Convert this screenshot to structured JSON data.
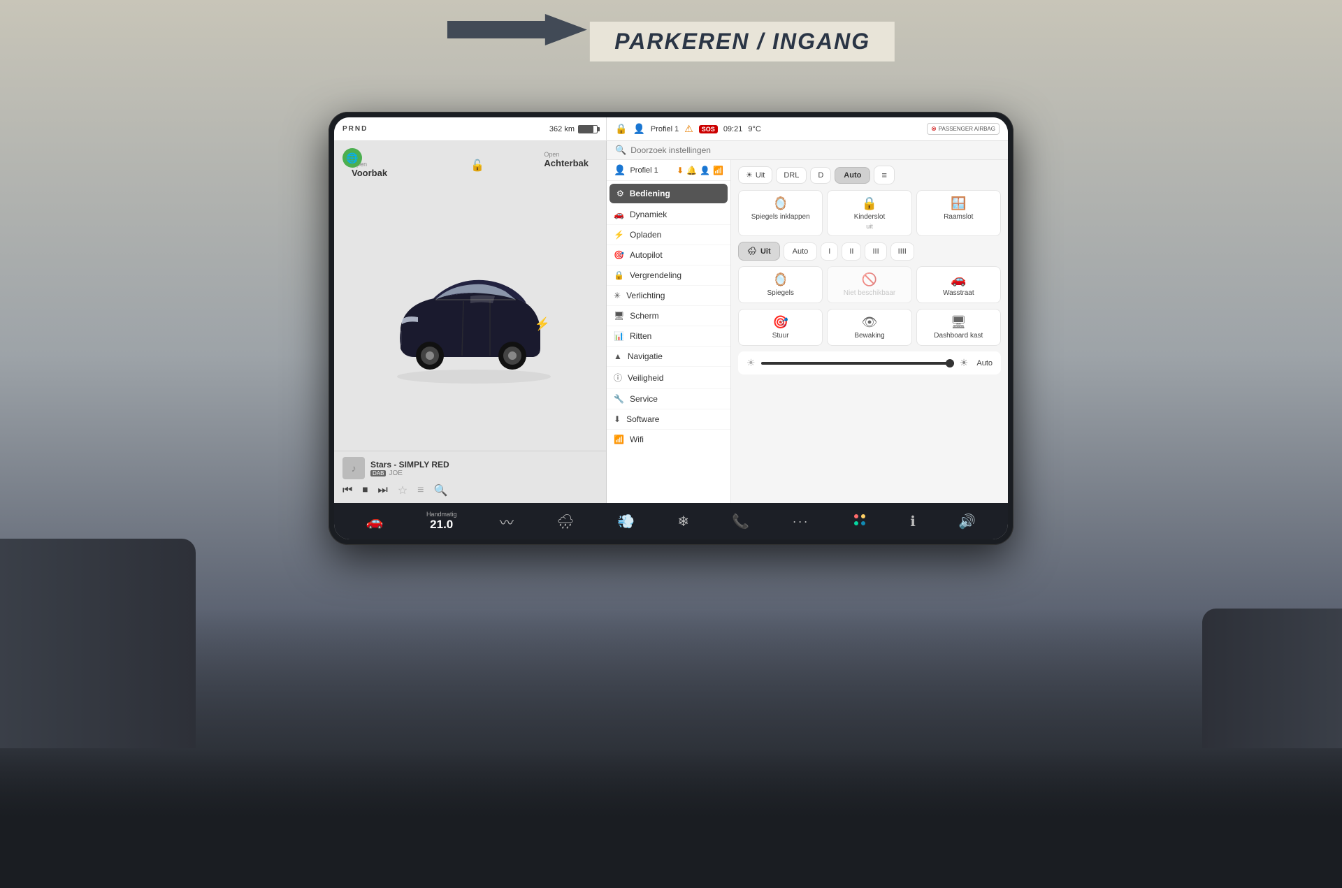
{
  "background": {
    "sign_text": "PARKEREN / INGANG"
  },
  "status_bar": {
    "gear": "PRND",
    "range": "362 km",
    "profile_label": "Profiel 1",
    "sos": "SOS",
    "time": "09:21",
    "temperature": "9°C",
    "passenger_airbag": "PASSENGER AIRBAG"
  },
  "car_panel": {
    "voorbak_open": "Open",
    "voorbak_label": "Voorbak",
    "achterbak_open": "Open",
    "achterbak_label": "Achterbak"
  },
  "music": {
    "title": "Stars - SIMPLY RED",
    "source_badge": "DAB",
    "source_name": "JOE"
  },
  "search": {
    "placeholder": "Doorzoek instellingen"
  },
  "profile": {
    "name": "Profiel 1"
  },
  "menu": {
    "items": [
      {
        "id": "bediening",
        "label": "Bediening",
        "icon": "⚙️",
        "active": true
      },
      {
        "id": "dynamiek",
        "label": "Dynamiek",
        "icon": "🚗"
      },
      {
        "id": "opladen",
        "label": "Opladen",
        "icon": "⚡"
      },
      {
        "id": "autopilot",
        "label": "Autopilot",
        "icon": "🎯"
      },
      {
        "id": "vergrendeling",
        "label": "Vergrendeling",
        "icon": "🔒"
      },
      {
        "id": "verlichting",
        "label": "Verlichting",
        "icon": "💡"
      },
      {
        "id": "scherm",
        "label": "Scherm",
        "icon": "🖥"
      },
      {
        "id": "ritten",
        "label": "Ritten",
        "icon": "📊"
      },
      {
        "id": "navigatie",
        "label": "Navigatie",
        "icon": "🧭"
      },
      {
        "id": "veiligheid",
        "label": "Veiligheid",
        "icon": "ℹ️"
      },
      {
        "id": "service",
        "label": "Service",
        "icon": "🔧"
      },
      {
        "id": "software",
        "label": "Software",
        "icon": "⬇️"
      },
      {
        "id": "wifi",
        "label": "Wifi",
        "icon": "📶"
      }
    ]
  },
  "quick_settings": {
    "light_options": [
      {
        "label": "Uit",
        "active": false
      },
      {
        "label": "DRL",
        "active": false
      },
      {
        "label": "D",
        "active": false
      },
      {
        "label": "Auto",
        "active": true
      },
      {
        "label": "≡",
        "active": false
      }
    ]
  },
  "control_grid": {
    "row1": [
      {
        "label": "Spiegels inklappen",
        "sub": ""
      },
      {
        "label": "Kinderslot",
        "sub": "uit"
      },
      {
        "label": "Raamslot",
        "sub": ""
      }
    ]
  },
  "wiper_settings": {
    "off_label": "Uit",
    "auto_label": "Auto",
    "speeds": [
      "I",
      "II",
      "III",
      "IIII"
    ]
  },
  "lower_grid": {
    "items": [
      {
        "label": "Spiegels",
        "available": true
      },
      {
        "label": "Niet beschikbaar",
        "available": false
      },
      {
        "label": "Wasstraat",
        "available": true
      }
    ],
    "row2": [
      {
        "label": "Stuur",
        "available": true
      },
      {
        "label": "Bewaking",
        "available": true
      },
      {
        "label": "Dashboard kast",
        "available": true
      }
    ]
  },
  "brightness": {
    "auto_label": "Auto"
  },
  "taskbar": {
    "items": [
      {
        "id": "car",
        "icon": "🚗"
      },
      {
        "id": "temp",
        "label_top": "Handmatig",
        "value": "21.0",
        "unit": ""
      },
      {
        "id": "heat",
        "icon": "〰️"
      },
      {
        "id": "wiper",
        "icon": "🌧"
      },
      {
        "id": "fan",
        "icon": "💨"
      },
      {
        "id": "defrost",
        "icon": "❄️"
      },
      {
        "id": "phone",
        "icon": "📞"
      },
      {
        "id": "dots",
        "icon": "···"
      },
      {
        "id": "apps",
        "icon": "✦"
      },
      {
        "id": "info",
        "icon": "ℹ️"
      },
      {
        "id": "volume",
        "icon": "🔊"
      }
    ]
  }
}
